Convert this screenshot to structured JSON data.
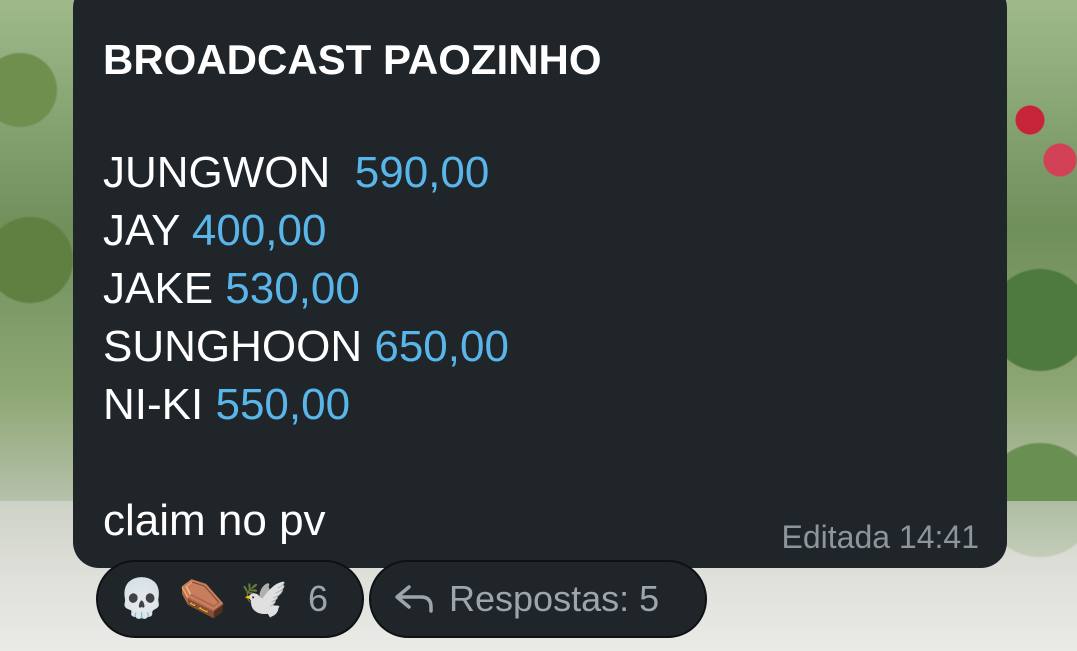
{
  "message": {
    "title": "BROADCAST PAOZINHO",
    "entries": [
      {
        "name": "JUNGWON",
        "gap": "  ",
        "price": "590,00"
      },
      {
        "name": "JAY",
        "gap": " ",
        "price": "400,00"
      },
      {
        "name": "JAKE",
        "gap": " ",
        "price": "530,00"
      },
      {
        "name": "SUNGHOON",
        "gap": " ",
        "price": "650,00"
      },
      {
        "name": "NI-KI",
        "gap": " ",
        "price": "550,00"
      }
    ],
    "footer": "claim no pv",
    "edited_label": "Editada 14:41"
  },
  "reactions": {
    "items": [
      "💀",
      "⚰️",
      "🕊️"
    ],
    "count": "6"
  },
  "replies": {
    "label": "Respostas: 5",
    "icon": "reply-arrow-icon"
  },
  "colors": {
    "bubble": "#1f2529",
    "accent": "#59b6ea",
    "muted": "#8f969b"
  }
}
